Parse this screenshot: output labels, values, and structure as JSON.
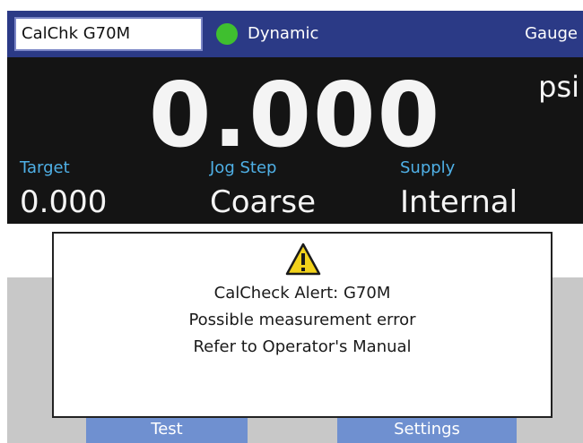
{
  "header": {
    "device_name": "CalChk G70M",
    "status_text": "Dynamic",
    "mode_text": "Gauge"
  },
  "main": {
    "reading": "0.000",
    "unit": "psi"
  },
  "fields": [
    {
      "label": "Target",
      "value": "0.000"
    },
    {
      "label": "Jog Step",
      "value": "Coarse"
    },
    {
      "label": "Supply",
      "value": "Internal"
    }
  ],
  "buttons": {
    "test_label": "Test",
    "settings_label": "Settings"
  },
  "dialog": {
    "icon": "warning-triangle-icon",
    "title": "CalCheck Alert:  G70M",
    "line2": "Possible measurement error",
    "line3": "Refer to Operator's Manual"
  },
  "colors": {
    "header_bg": "#2b3a86",
    "status_ok": "#3fbf2f",
    "label_blue": "#4fb0e6",
    "button_blue": "#6f90d0",
    "warning_yellow": "#f2d21b"
  }
}
